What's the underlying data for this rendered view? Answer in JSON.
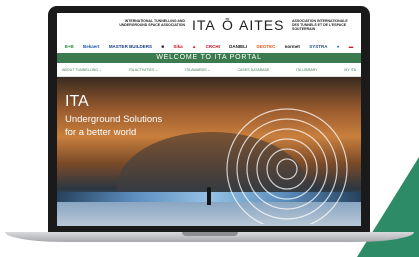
{
  "header": {
    "left_small": "INTERNATIONAL TUNNELLING AND UNDERGROUND SPACE ASSOCIATION",
    "logo_left": "ITA",
    "logo_sep": "Ō",
    "logo_right": "AITES",
    "right_small": "ASSOCIATION INTERNATIONALE DES TUNNELS ET DE L'ESPACE SOUTERRAIN"
  },
  "sponsors": [
    {
      "label": "B+B",
      "color": "#2e8b3d"
    },
    {
      "label": "Bekaert",
      "color": "#1a5aa8"
    },
    {
      "label": "MASTER BUILDERS",
      "color": "#1a3c8a"
    },
    {
      "label": "■",
      "color": "#111111"
    },
    {
      "label": "Sika",
      "color": "#c2141b"
    },
    {
      "label": "▲",
      "color": "#e2231a"
    },
    {
      "label": "CRCHI",
      "color": "#c1121f"
    },
    {
      "label": "DANIELI",
      "color": "#1a1a1a"
    },
    {
      "label": "GEOTEC",
      "color": "#d9541a"
    },
    {
      "label": "normet",
      "color": "#111111"
    },
    {
      "label": "SYSTRA",
      "color": "#1f4d8f"
    },
    {
      "label": "●",
      "color": "#2f6db3"
    },
    {
      "label": "▬",
      "color": "#c71b2b"
    }
  ],
  "welcome": "WELCOME TO ITA PORTAL",
  "nav": [
    "ABOUT TUNNELLING ⌄",
    "ITA ACTIVITIES ⌄",
    "ITA AWARDS ⌄",
    "CASES DATABASE",
    "ITA LIBRARY",
    "MY ITA"
  ],
  "hero": {
    "title": "ITA",
    "subtitle_line1": "Underground Solutions",
    "subtitle_line2": "for a better world"
  }
}
